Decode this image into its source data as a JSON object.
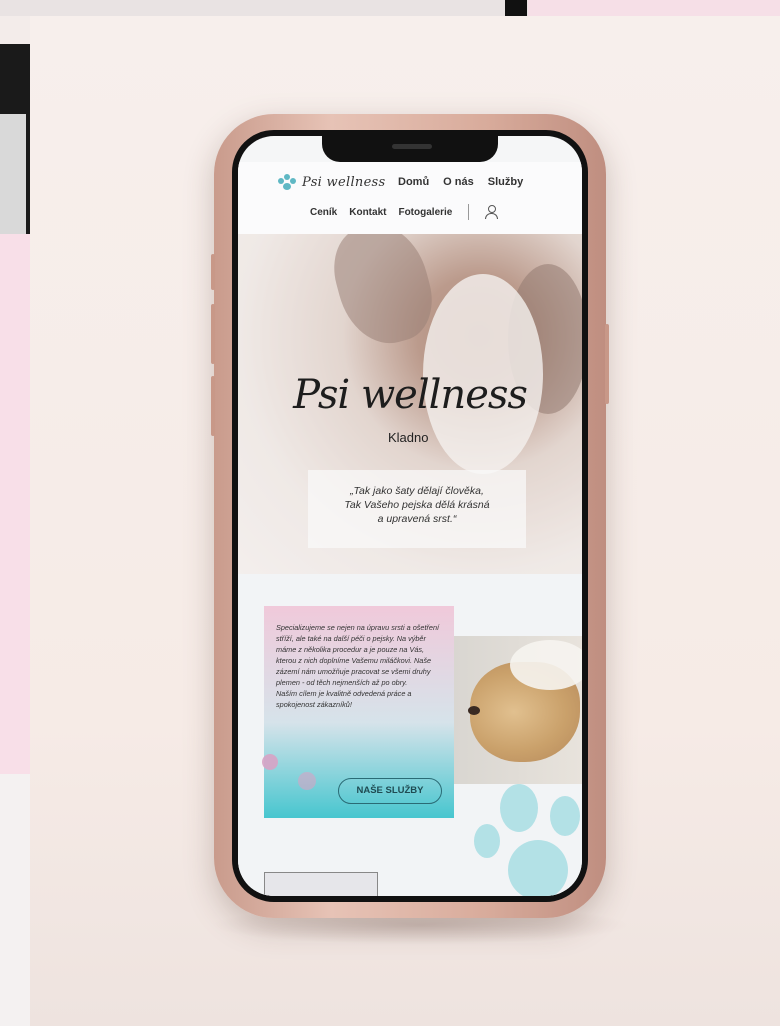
{
  "site": {
    "logo_text": "Psi wellness",
    "nav": {
      "row1": [
        "Domů",
        "O nás",
        "Služby"
      ],
      "row2": [
        "Ceník",
        "Kontakt",
        "Fotogalerie"
      ]
    },
    "hero": {
      "title": "Psi wellness",
      "subtitle": "Kladno",
      "quote_line1": "„Tak jako šaty dělají člověka,",
      "quote_line2": "Tak Vašeho pejska dělá krásná",
      "quote_line3": "a upravená srst.“"
    },
    "intro": {
      "text": "Specializujeme se nejen na úpravu srsti a ošetření stříží, ale také na další péči o pejsky. Na výběr máme z několika procedur a je pouze na Vás, kterou z nich doplníme Vašemu miláčkovi. Naše zázemí nám umožňuje pracovat se všemi druhy plemen - od těch nejmenších až po obry.",
      "goal": "Naším cílem je kvalitně odvedená práce a spokojenost zákazníků!",
      "cta_label": "NAŠE SLUŽBY"
    }
  },
  "colors": {
    "accent_teal": "#47c6cf",
    "accent_pink": "#f0c9da",
    "phone_rose_gold": "#d8ab9b"
  },
  "icons": [
    "paw-logo-icon",
    "user-icon",
    "paw-icon"
  ]
}
